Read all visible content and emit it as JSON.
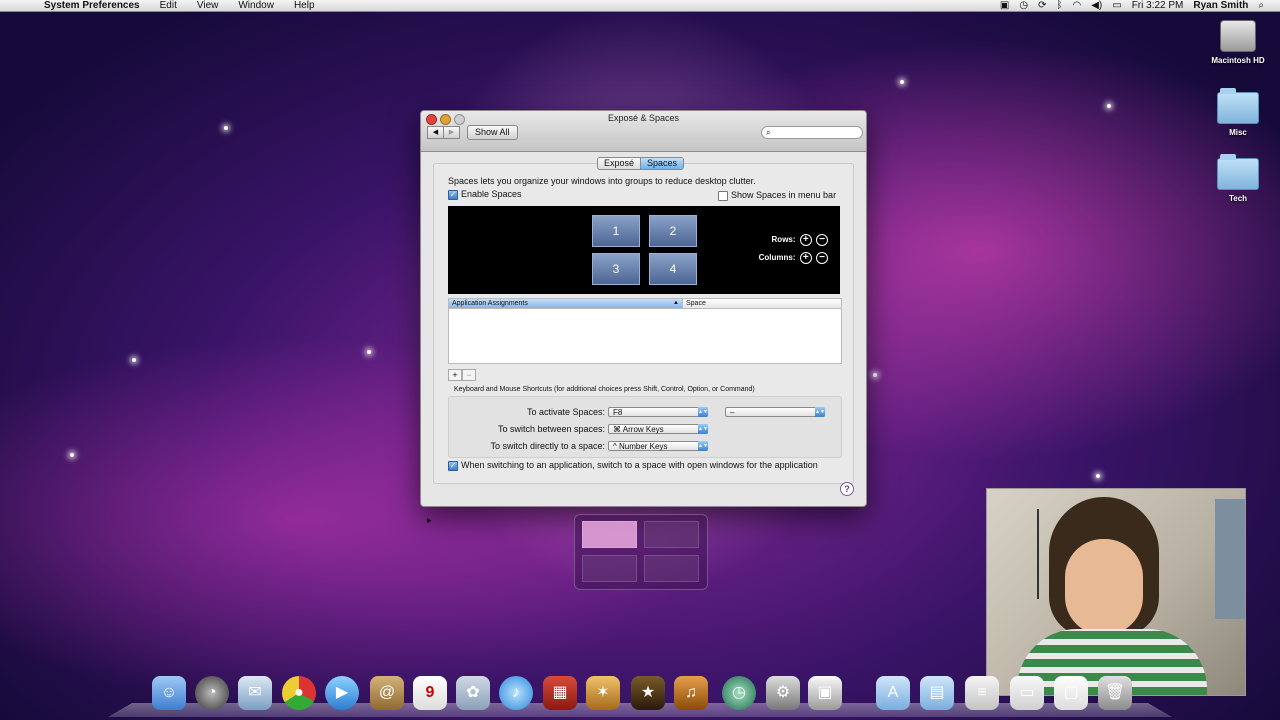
{
  "menubar": {
    "apple": "",
    "app_name": "System Preferences",
    "menus": [
      "Edit",
      "View",
      "Window",
      "Help"
    ],
    "clock": "Fri 3:22 PM",
    "user": "Ryan Smith"
  },
  "desktop": {
    "icons": [
      {
        "label": "Macintosh HD",
        "kind": "drive"
      },
      {
        "label": "Misc",
        "kind": "folder"
      },
      {
        "label": "Tech",
        "kind": "folder"
      }
    ]
  },
  "window": {
    "title": "Exposé & Spaces",
    "back": "◀",
    "forward": "▶",
    "show_all": "Show All",
    "search_icon": "⌕",
    "search_placeholder": "",
    "tabs": [
      {
        "label": "Exposé",
        "active": false
      },
      {
        "label": "Spaces",
        "active": true
      }
    ],
    "description": "Spaces lets you organize your windows into groups to reduce desktop clutter.",
    "enable_spaces": {
      "label": "Enable Spaces",
      "checked": true
    },
    "show_in_menubar": {
      "label": "Show Spaces in menu bar",
      "checked": false
    },
    "spaces": [
      "1",
      "2",
      "3",
      "4"
    ],
    "rows_label": "Rows:",
    "columns_label": "Columns:",
    "plus": "+",
    "minus": "−",
    "table": {
      "col1": "Application Assignments",
      "col2": "Space",
      "sort_indicator": "▲"
    },
    "add": "+",
    "remove": "−",
    "shortcuts_title": "Keyboard and Mouse Shortcuts (for additional choices press Shift, Control, Option, or Command)",
    "shortcuts": [
      {
        "label": "To activate Spaces:",
        "value": "F8",
        "secondary": "–"
      },
      {
        "label": "To switch between spaces:",
        "value": "⌘ Arrow Keys"
      },
      {
        "label": "To switch directly to a space:",
        "value": "^ Number Keys"
      }
    ],
    "switch_option": {
      "label": "When switching to an application, switch to a space with open windows for the application",
      "checked": true
    },
    "help": "?"
  },
  "colors": {
    "accent": "#3a7fd0",
    "tab_active": "#6fb0ec"
  }
}
